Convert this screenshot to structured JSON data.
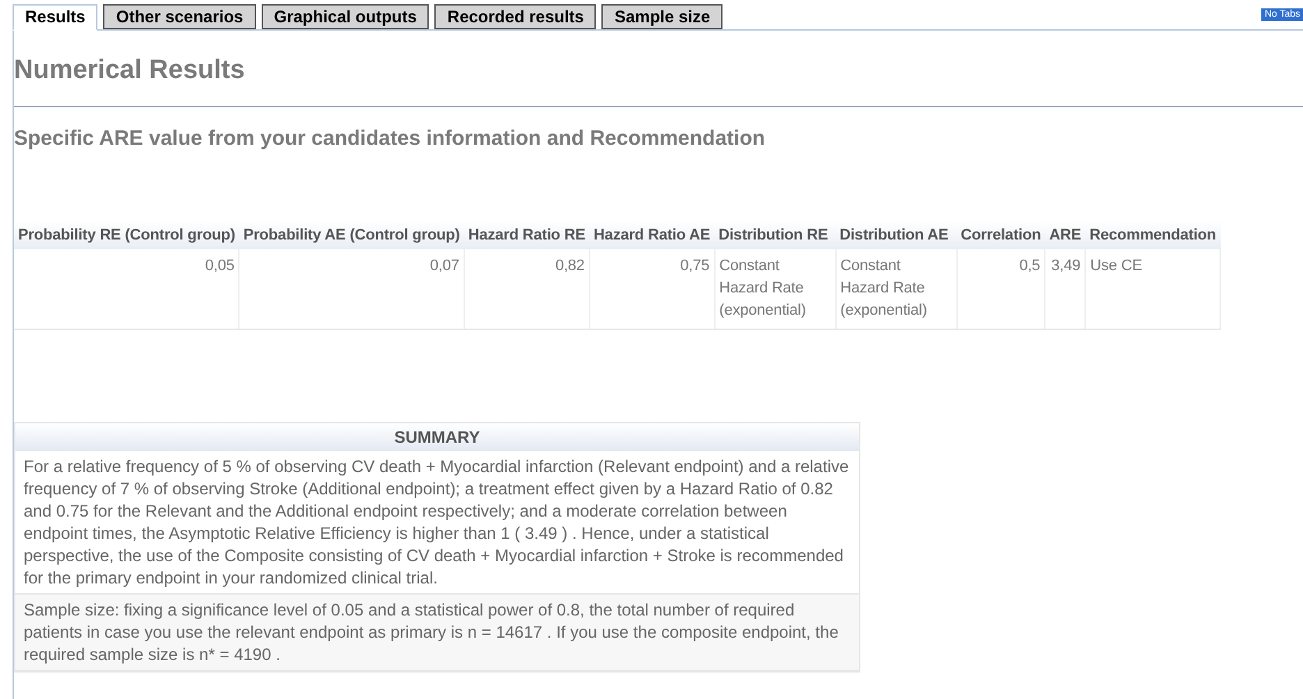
{
  "tabs": [
    {
      "label": "Results",
      "selected": true
    },
    {
      "label": "Other scenarios",
      "selected": false
    },
    {
      "label": "Graphical outputs",
      "selected": false
    },
    {
      "label": "Recorded results",
      "selected": false
    },
    {
      "label": "Sample size",
      "selected": false
    }
  ],
  "no_tabs_button": "No Tabs",
  "heading": "Numerical Results",
  "subheading": "Specific ARE value from your candidates information and Recommendation",
  "table": {
    "columns": [
      {
        "label": "Probability RE (Control group)",
        "kind": "number"
      },
      {
        "label": "Probability AE (Control group)",
        "kind": "number"
      },
      {
        "label": "Hazard Ratio RE",
        "kind": "number"
      },
      {
        "label": "Hazard Ratio AE",
        "kind": "number"
      },
      {
        "label": "Distribution RE",
        "kind": "text"
      },
      {
        "label": "Distribution AE",
        "kind": "text"
      },
      {
        "label": "Correlation",
        "kind": "number"
      },
      {
        "label": "ARE",
        "kind": "number"
      },
      {
        "label": "Recommendation",
        "kind": "text"
      }
    ],
    "rows": [
      [
        "0,05",
        "0,07",
        "0,82",
        "0,75",
        "Constant Hazard Rate (exponential)",
        "Constant Hazard Rate (exponential)",
        "0,5",
        "3,49",
        "Use CE"
      ]
    ]
  },
  "summary": {
    "title": "SUMMARY",
    "paragraphs": [
      "For a relative frequency of 5 % of observing CV death + Myocardial infarction (Relevant endpoint) and a relative frequency of 7 % of observing Stroke (Additional endpoint); a treatment effect given by a Hazard Ratio of 0.82 and 0.75 for the Relevant and the Additional endpoint respectively; and a moderate correlation between endpoint times, the Asymptotic Relative Efficiency is higher than 1 ( 3.49 ) . Hence, under a statistical perspective, the use of the Composite consisting of CV death + Myocardial infarction + Stroke is recommended for the primary endpoint in your randomized clinical trial.",
      "Sample size: fixing a significance level of 0.05 and a statistical power of 0.8, the total number of required patients in case you use the relevant endpoint as primary is n = 14617 . If you use the composite endpoint, the required sample size is n* = 4190 ."
    ]
  }
}
